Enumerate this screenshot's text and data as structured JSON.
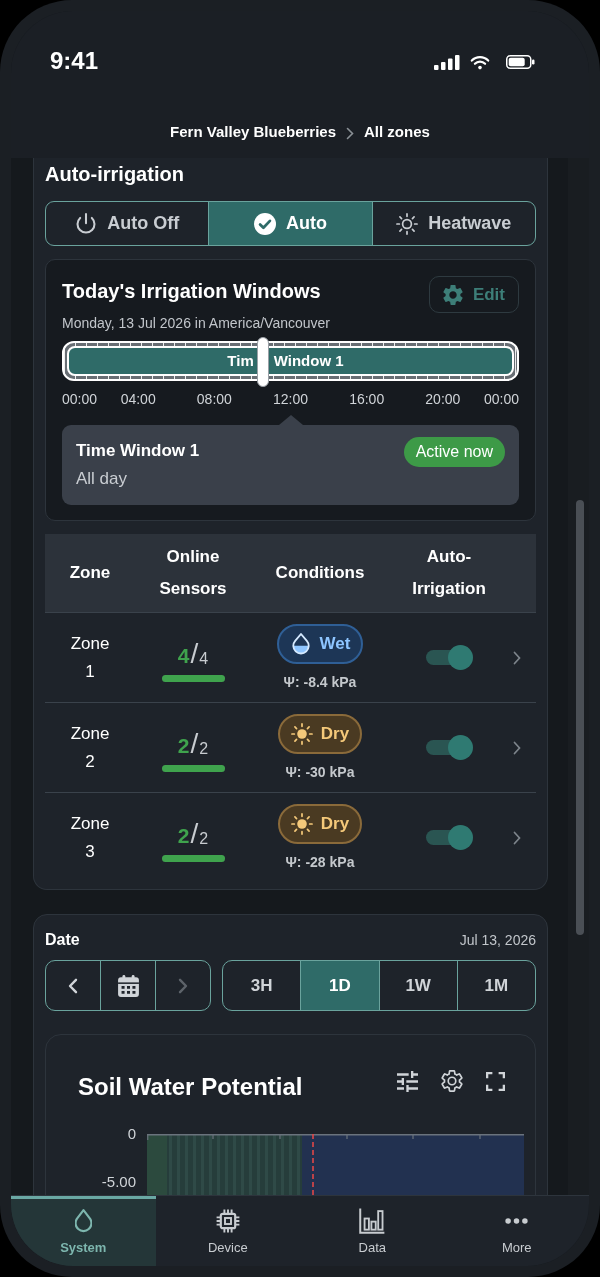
{
  "status_bar": {
    "time": "9:41"
  },
  "breadcrumb": [
    {
      "label": "Fern Valley Blueberries"
    },
    {
      "label": "All zones"
    }
  ],
  "auto_irrigation": {
    "title": "Auto-irrigation",
    "modes": [
      {
        "label": "Auto Off",
        "selected": false
      },
      {
        "label": "Auto",
        "selected": true
      },
      {
        "label": "Heatwave",
        "selected": false
      }
    ],
    "windows": {
      "title": "Today's Irrigation Windows",
      "edit_button": "Edit",
      "date": "Monday, 13 Jul 2026 in America/Vancouver",
      "bars": [
        {
          "label_parts": [
            "Tim",
            "Window 1"
          ]
        }
      ],
      "now_marker": {
        "level": 0.44
      },
      "ticks": [
        "00:00",
        "04:00",
        "08:00",
        "12:00",
        "16:00",
        "20:00",
        "00:00"
      ],
      "detail": {
        "title": "Time Window 1",
        "subtitle": "All day",
        "badge": "Active now"
      }
    },
    "zones": {
      "columns": [
        "Zone",
        "Online Sensors",
        "Conditions",
        "Auto-Irrigation"
      ],
      "rows": [
        {
          "zone": "Zone 1",
          "online": "4",
          "slash": "/",
          "total": "4",
          "level": 1,
          "condition": {
            "kind": "wet",
            "label": "Wet"
          },
          "potential": "Ψ: -8.4 kPa",
          "auto_irrigation": true
        },
        {
          "zone": "Zone 2",
          "online": "2",
          "slash": "/",
          "total": "2",
          "level": 1,
          "condition": {
            "kind": "dry",
            "label": "Dry"
          },
          "potential": "Ψ: -30 kPa",
          "auto_irrigation": true
        },
        {
          "zone": "Zone 3",
          "online": "2",
          "slash": "/",
          "total": "2",
          "level": 1,
          "condition": {
            "kind": "dry",
            "label": "Dry"
          },
          "potential": "Ψ: -28 kPa",
          "auto_irrigation": true
        }
      ]
    }
  },
  "date_panel": {
    "title": "Date",
    "date": "Jul 13, 2026",
    "nav": [
      {
        "kind": "previous",
        "disabled": false
      },
      {
        "kind": "calendar",
        "disabled": false
      },
      {
        "kind": "next",
        "disabled": true
      }
    ],
    "ranges": [
      {
        "label": "3H",
        "selected": false
      },
      {
        "label": "1D",
        "selected": true
      },
      {
        "label": "1W",
        "selected": false
      },
      {
        "label": "1M",
        "selected": false
      }
    ]
  },
  "chart": {
    "title": "Soil Water Potential",
    "y_labels": [
      "0",
      "-5.00"
    ]
  },
  "bottom_nav": [
    {
      "label": "System",
      "selected": true
    },
    {
      "label": "Device",
      "selected": false
    },
    {
      "label": "Data",
      "selected": false
    },
    {
      "label": "More",
      "selected": false
    }
  ]
}
